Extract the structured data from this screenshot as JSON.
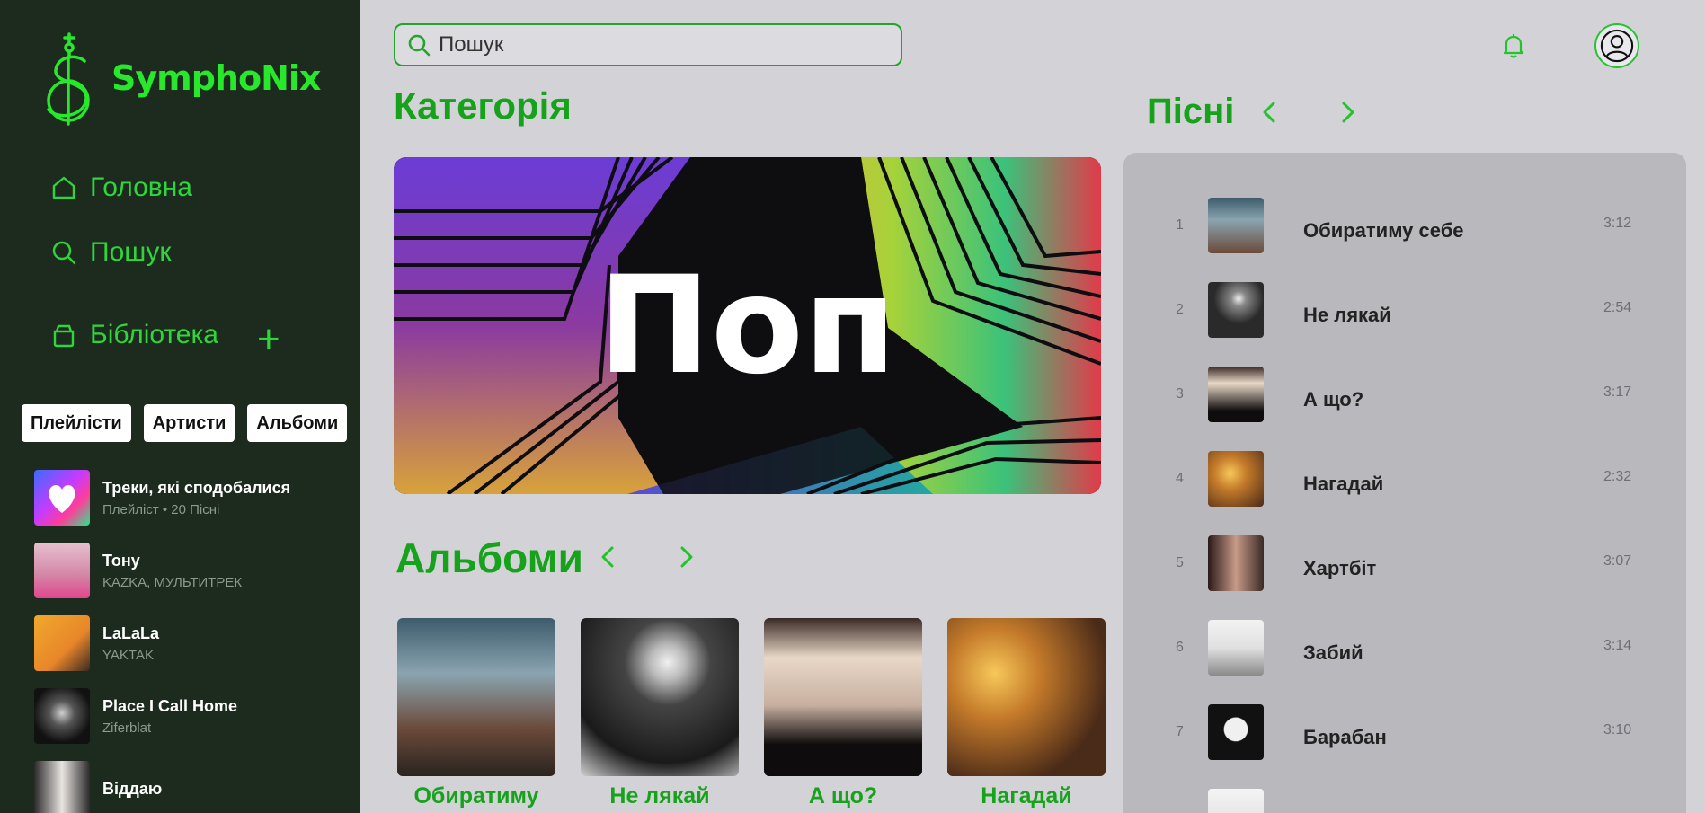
{
  "app": {
    "name": "SymphoNix"
  },
  "colors": {
    "accent": "#16a31b",
    "sidebar_bg": "#1c2b1e",
    "page_bg": "#d3d2d7",
    "panel_bg": "#b8b8bd"
  },
  "sidebar": {
    "nav": [
      {
        "label": "Головна",
        "icon": "home-icon"
      },
      {
        "label": "Пошук",
        "icon": "search-icon"
      },
      {
        "label": "Бібліотека",
        "icon": "library-icon"
      }
    ],
    "add_label": "+",
    "filters": [
      "Плейлісти",
      "Артисти",
      "Альбоми"
    ],
    "library": [
      {
        "title": "Треки, які сподобалися",
        "subtitle": "Плейліст • 20 Пісні"
      },
      {
        "title": "Тону",
        "subtitle": "KAZKA, МУЛЬТИТРЕК"
      },
      {
        "title": "LaLaLa",
        "subtitle": "YAKTAK"
      },
      {
        "title": "Place I Call Home",
        "subtitle": "Ziferblat"
      },
      {
        "title": "Віддаю",
        "subtitle": ""
      }
    ]
  },
  "search": {
    "placeholder": "Пошук"
  },
  "main": {
    "category_heading": "Категорія",
    "banner_label": "Поп",
    "albums_heading": "Альбоми",
    "albums": [
      {
        "title": "Обиратиму"
      },
      {
        "title": "Не лякай"
      },
      {
        "title": "А що?"
      },
      {
        "title": "Нагадай"
      }
    ]
  },
  "songs": {
    "heading": "Пісні",
    "items": [
      {
        "num": "1",
        "title": "Обиратиму себе",
        "duration": "3:12"
      },
      {
        "num": "2",
        "title": "Не лякай",
        "duration": "2:54"
      },
      {
        "num": "3",
        "title": "А що?",
        "duration": "3:17"
      },
      {
        "num": "4",
        "title": "Нагадай",
        "duration": "2:32"
      },
      {
        "num": "5",
        "title": "Хартбіт",
        "duration": "3:07"
      },
      {
        "num": "6",
        "title": "Забий",
        "duration": "3:14"
      },
      {
        "num": "7",
        "title": "Барабан",
        "duration": "3:10"
      }
    ]
  }
}
